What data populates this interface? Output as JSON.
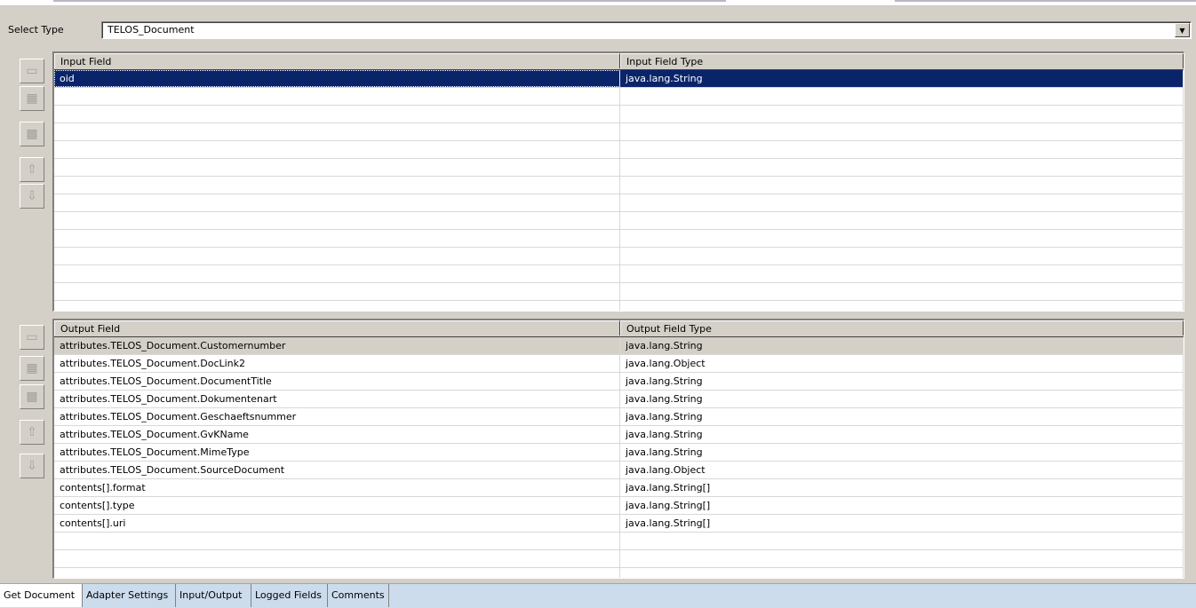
{
  "select_type": {
    "label": "Select Type",
    "value": "TELOS_Document"
  },
  "input_table": {
    "columns": [
      "Input Field",
      "Input Field Type"
    ],
    "rows": [
      [
        "oid",
        "java.lang.String"
      ]
    ]
  },
  "output_table": {
    "columns": [
      "Output Field",
      "Output Field Type"
    ],
    "rows": [
      [
        "attributes.TELOS_Document.Customernumber",
        "java.lang.String"
      ],
      [
        "attributes.TELOS_Document.DocLink2",
        "java.lang.Object"
      ],
      [
        "attributes.TELOS_Document.DocumentTitle",
        "java.lang.String"
      ],
      [
        "attributes.TELOS_Document.Dokumentenart",
        "java.lang.String"
      ],
      [
        "attributes.TELOS_Document.Geschaeftsnummer",
        "java.lang.String"
      ],
      [
        "attributes.TELOS_Document.GvKName",
        "java.lang.String"
      ],
      [
        "attributes.TELOS_Document.MimeType",
        "java.lang.String"
      ],
      [
        "attributes.TELOS_Document.SourceDocument",
        "java.lang.Object"
      ],
      [
        "contents[].format",
        "java.lang.String[]"
      ],
      [
        "contents[].type",
        "java.lang.String[]"
      ],
      [
        "contents[].uri",
        "java.lang.String[]"
      ]
    ]
  },
  "toolbar_icons": [
    "add-row-icon",
    "insert-row-icon",
    "delete-row-icon",
    "move-up-icon",
    "move-down-icon"
  ],
  "tabs": [
    {
      "label": "Get Document",
      "active": true
    },
    {
      "label": "Adapter Settings",
      "active": false
    },
    {
      "label": "Input/Output",
      "active": false
    },
    {
      "label": "Logged Fields",
      "active": false
    },
    {
      "label": "Comments",
      "active": false
    }
  ],
  "colors": {
    "selection_dark": "#0a246a",
    "selection_light": "#d4d0c8",
    "panel_bg": "#d4d0c8",
    "tab_bar": "#ccdcec"
  }
}
